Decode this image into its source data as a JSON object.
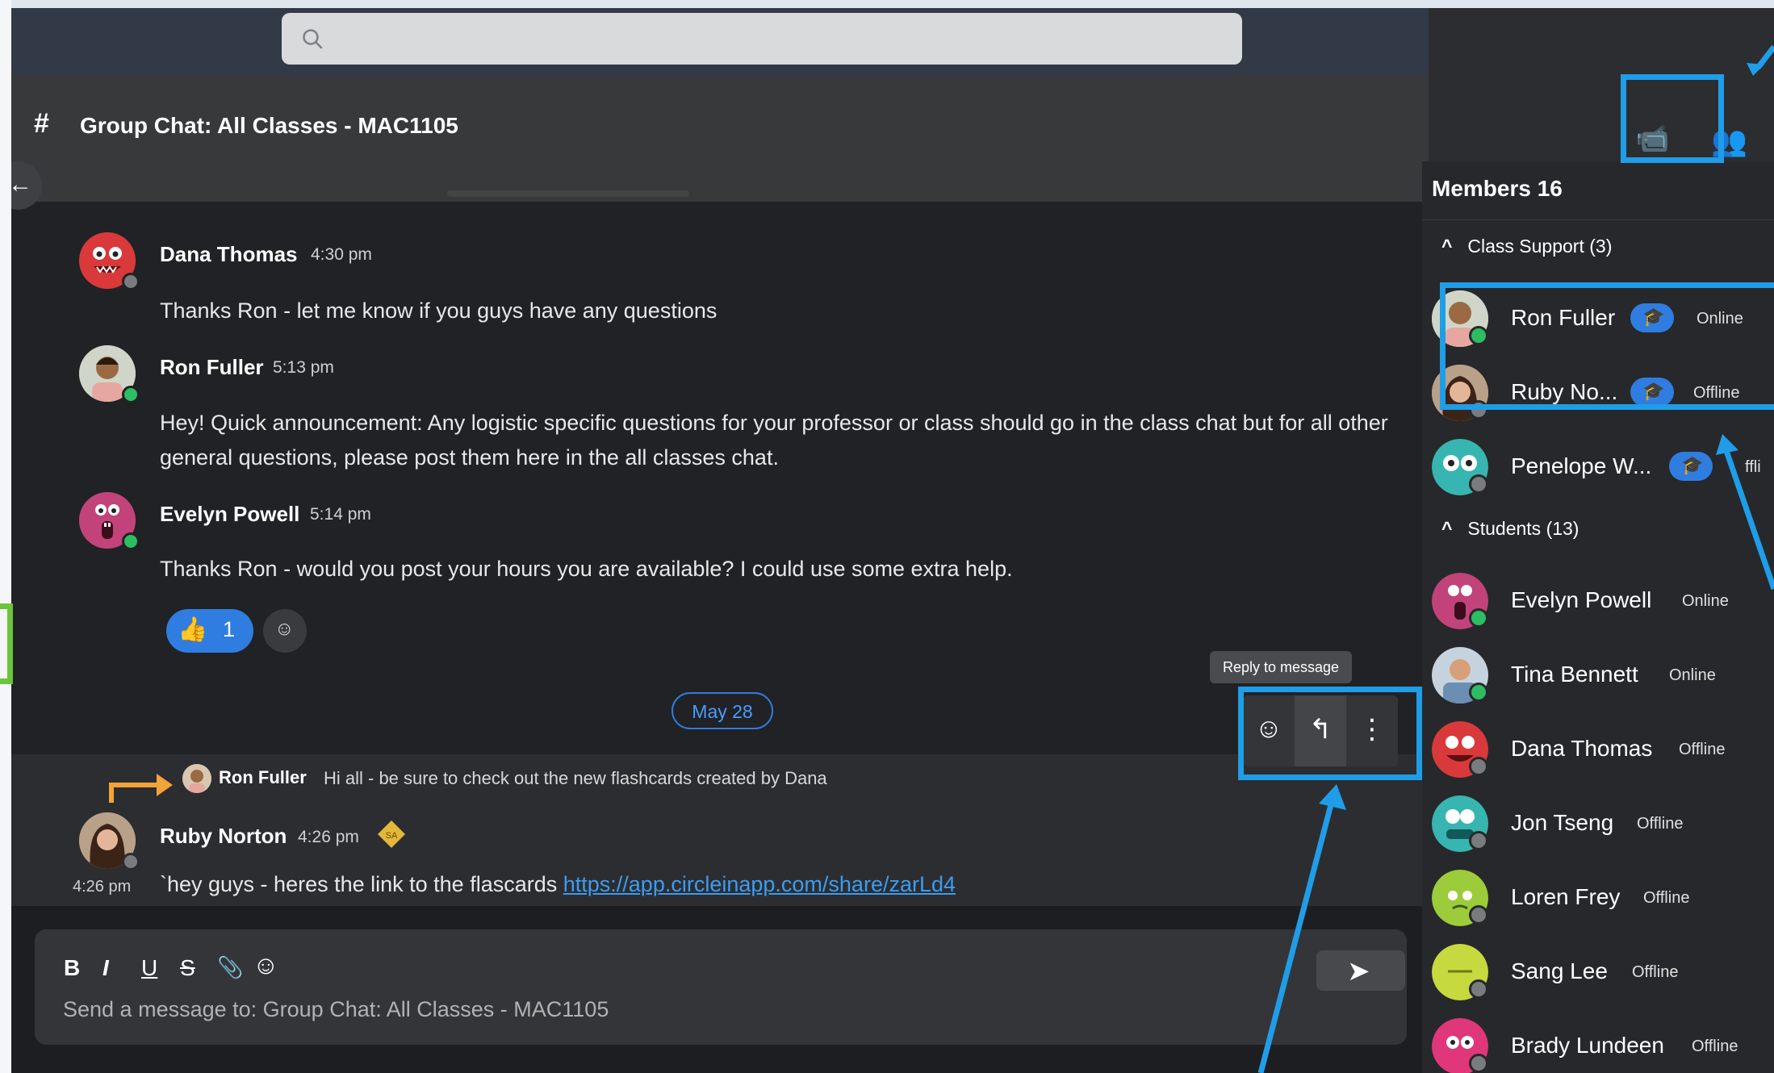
{
  "search": {
    "placeholder": ""
  },
  "channel": {
    "hash": "#",
    "title": "Group Chat: All Classes - MAC1105"
  },
  "messages": [
    {
      "name": "Dana Thomas",
      "time": "4:30 pm",
      "text": "Thanks Ron - let me know if you guys have any questions"
    },
    {
      "name": "Ron Fuller",
      "time": "5:13 pm",
      "text": "Hey! Quick announcement: Any logistic specific questions for your professor or class should go in the class chat but for all other general questions, please post them here in the all classes chat."
    },
    {
      "name": "Evelyn Powell",
      "time": "5:14 pm",
      "text": "Thanks Ron - would you post your hours you are available? I could use some extra help."
    }
  ],
  "reaction": {
    "emoji": "👍",
    "count": "1"
  },
  "date_divider": "May 28",
  "reply_preview": {
    "name": "Ron Fuller",
    "text": "Hi all - be sure to check out the new flashcards created by Dana"
  },
  "hovered_message": {
    "name": "Ruby Norton",
    "time": "4:26 pm",
    "badge": "SA",
    "side_time": "4:26 pm",
    "text_prefix": "`hey guys - heres the link to the flascards ",
    "link": "https://app.circleinapp.com/share/zarLd4"
  },
  "tooltip": "Reply to message",
  "composer": {
    "placeholder": "Send a message to: Group Chat: All Classes - MAC1105",
    "tools": [
      "B",
      "I",
      "U",
      "S",
      "📎",
      "☺"
    ]
  },
  "members": {
    "header": "Members 16",
    "groups": [
      {
        "label": "Class Support (3)",
        "items": [
          {
            "name": "Ron Fuller",
            "status": "Online",
            "online": true,
            "badge": true
          },
          {
            "name": "Ruby No...",
            "status": "Offline",
            "online": false,
            "badge": true
          },
          {
            "name": "Penelope W...",
            "status": "ffli",
            "online": false,
            "badge": true
          }
        ]
      },
      {
        "label": "Students (13)",
        "items": [
          {
            "name": "Evelyn Powell",
            "status": "Online",
            "online": true
          },
          {
            "name": "Tina Bennett",
            "status": "Online",
            "online": true
          },
          {
            "name": "Dana Thomas",
            "status": "Offline",
            "online": false
          },
          {
            "name": "Jon Tseng",
            "status": "Offline",
            "online": false
          },
          {
            "name": "Loren Frey",
            "status": "Offline",
            "online": false
          },
          {
            "name": "Sang Lee",
            "status": "Offline",
            "online": false
          },
          {
            "name": "Brady Lundeen",
            "status": "Offline",
            "online": false
          }
        ]
      }
    ]
  },
  "colors": {
    "accent": "#2f7de0",
    "annotation": "#1f9de8",
    "online": "#2dbd62"
  }
}
